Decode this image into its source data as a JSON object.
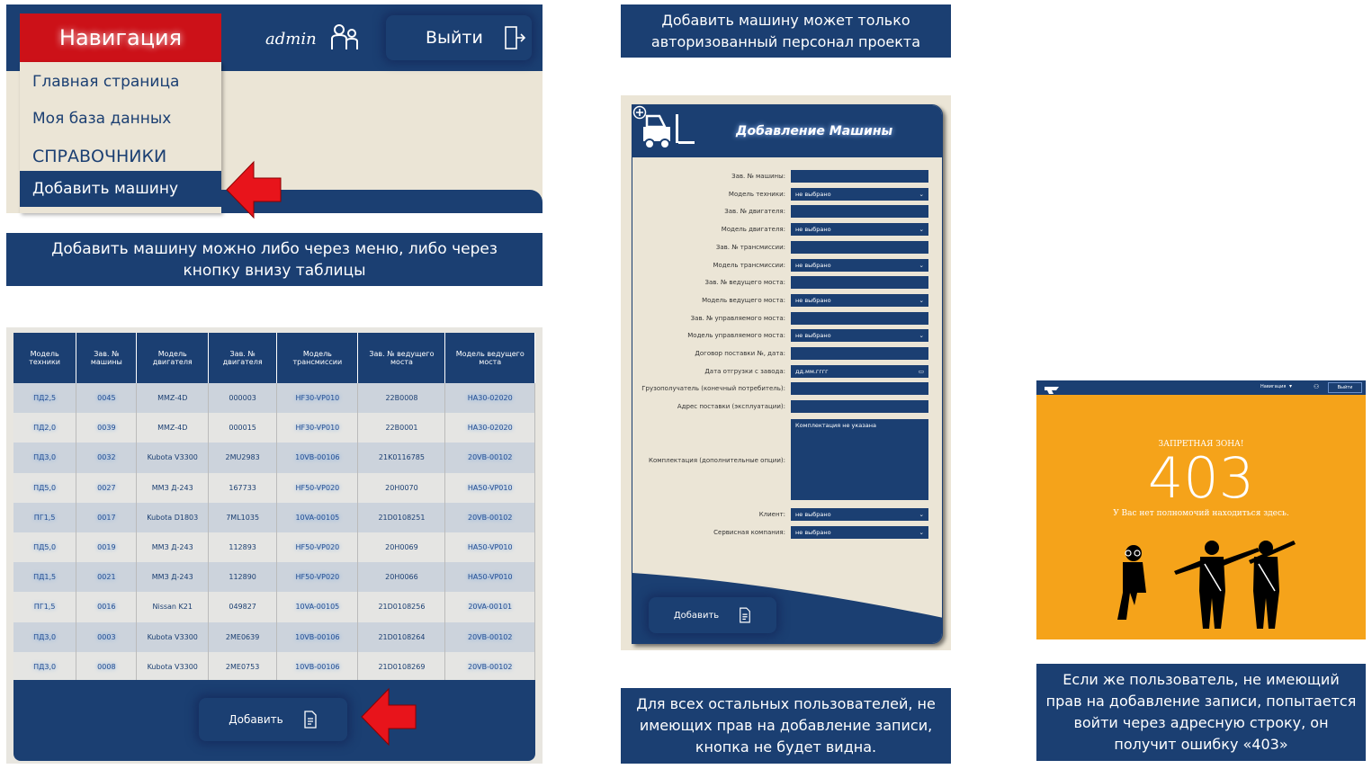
{
  "panel1": {
    "nav_title": "Навигация",
    "user": "admin",
    "exit_label": "Выйти",
    "menu": [
      "Главная страница",
      "Моя база данных",
      "СПРАВОЧНИКИ",
      "Добавить машину"
    ]
  },
  "captions": {
    "top_left": "Добавить машину можно либо через меню, либо через кнопку внизу таблицы",
    "top_middle": "Добавить машину может только авторизованный персонал проекта",
    "bottom_middle": "Для всех остальных пользователей, не имеющих прав на добавление записи, кнопка не будет видна.",
    "bottom_right": "Если же пользователь, не имеющий прав на добавление записи, попытается войти через адресную строку, он получит ошибку «403»"
  },
  "table": {
    "headers": [
      "Модель техники",
      "Зав. № машины",
      "Модель двигателя",
      "Зав. № двигателя",
      "Модель трансмиссии",
      "Зав. № ведущего моста",
      "Модель ведущего моста"
    ],
    "rows": [
      [
        "ПД2,5",
        "0045",
        "MMZ-4D",
        "000003",
        "HF30-VP010",
        "22B0008",
        "HA30-02020"
      ],
      [
        "ПД2,0",
        "0039",
        "MMZ-4D",
        "000015",
        "HF30-VP010",
        "22B0001",
        "HA30-02020"
      ],
      [
        "ПД3,0",
        "0032",
        "Kubota V3300",
        "2MU2983",
        "10VB-00106",
        "21K0116785",
        "20VB-00102"
      ],
      [
        "ПД5,0",
        "0027",
        "ММЗ Д-243",
        "167733",
        "HF50-VP020",
        "20H0070",
        "HA50-VP010"
      ],
      [
        "ПГ1,5",
        "0017",
        "Kubota D1803",
        "7ML1035",
        "10VA-00105",
        "21D0108251",
        "20VB-00102"
      ],
      [
        "ПД5,0",
        "0019",
        "ММЗ Д-243",
        "112893",
        "HF50-VP020",
        "20H0069",
        "HA50-VP010"
      ],
      [
        "ПД1,5",
        "0021",
        "ММЗ Д-243",
        "112890",
        "HF50-VP020",
        "20H0066",
        "HA50-VP010"
      ],
      [
        "ПГ1,5",
        "0016",
        "Nissan K21",
        "049827",
        "10VA-00105",
        "21D0108256",
        "20VA-00101"
      ],
      [
        "ПД3,0",
        "0003",
        "Kubota V3300",
        "2ME0639",
        "10VB-00106",
        "21D0108264",
        "20VB-00102"
      ],
      [
        "ПД3,0",
        "0008",
        "Kubota V3300",
        "2ME0753",
        "10VB-00106",
        "21D0108269",
        "20VB-00102"
      ]
    ],
    "add_label": "Добавить"
  },
  "form": {
    "title": "Добавление Машины",
    "fields": [
      {
        "label": "Зав. № машины:",
        "value": ""
      },
      {
        "label": "Модель техники:",
        "value": "не выбрано",
        "select": true
      },
      {
        "label": "Зав. № двигателя:",
        "value": ""
      },
      {
        "label": "Модель двигателя:",
        "value": "не выбрано",
        "select": true
      },
      {
        "label": "Зав. № трансмиссии:",
        "value": ""
      },
      {
        "label": "Модель трансмиссии:",
        "value": "не выбрано",
        "select": true
      },
      {
        "label": "Зав. № ведущего моста:",
        "value": ""
      },
      {
        "label": "Модель ведущего моста:",
        "value": "не выбрано",
        "select": true
      },
      {
        "label": "Зав. № управляемого моста:",
        "value": ""
      },
      {
        "label": "Модель управляемого моста:",
        "value": "не выбрано",
        "select": true
      },
      {
        "label": "Договор поставки №, дата:",
        "value": ""
      },
      {
        "label": "Дата отгрузки с завода:",
        "value": "дд.мм.гггг",
        "date": true
      },
      {
        "label": "Грузополучатель (конечный потребитель):",
        "value": ""
      },
      {
        "label": "Адрес поставки (эксплуатации):",
        "value": ""
      }
    ],
    "textarea_label": "Комплектация (дополнительные опции):",
    "textarea_value": "Комплектация не указана",
    "client_label": "Клиент:",
    "client_value": "не выбрано",
    "service_label": "Сервисная компания:",
    "service_value": "не выбрано",
    "add_label": "Добавить"
  },
  "error": {
    "heading": "ЗАПРЕТНАЯ ЗОНА!",
    "code": "403",
    "message": "У Вас нет полномочий находиться здесь.",
    "nav": "Навигация",
    "exit": "Выйти"
  },
  "colors": {
    "navy": "#1b3f72",
    "red": "#cc1118",
    "cream": "#ebe5d6",
    "orange": "#f5a31a"
  }
}
